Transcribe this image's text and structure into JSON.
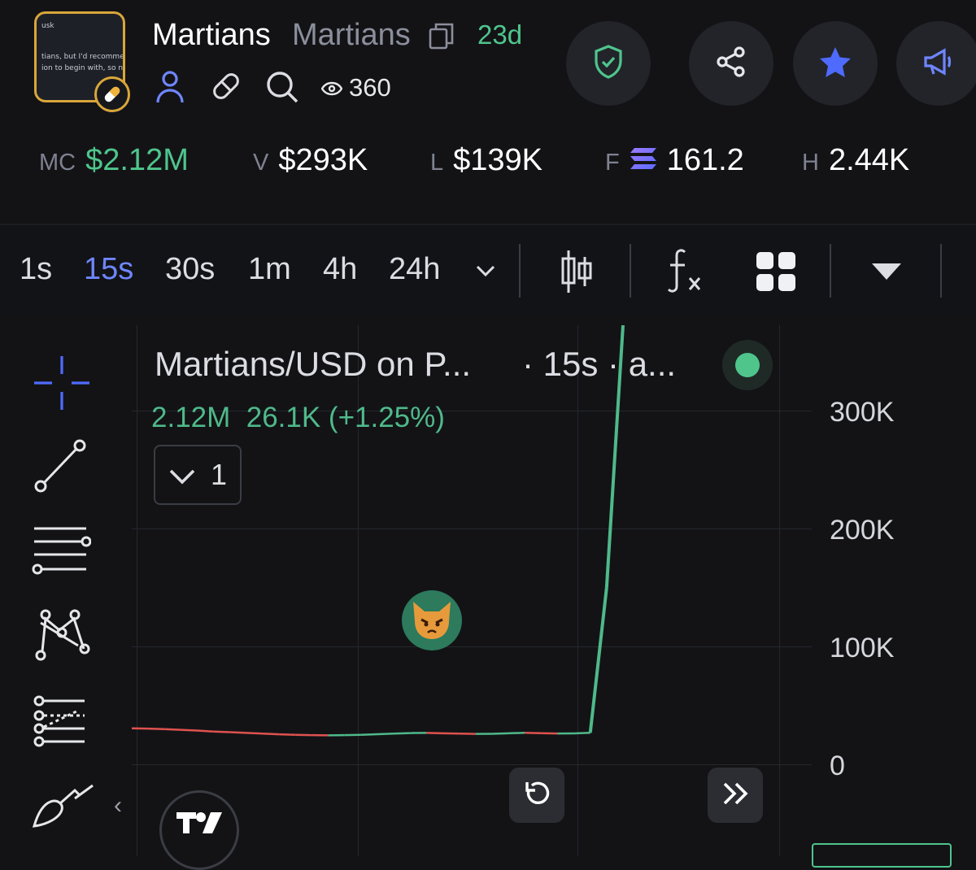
{
  "header": {
    "token_name": "Martians",
    "token_symbol": "Martians",
    "age": "23d",
    "views": "360",
    "avatar_tweet": {
      "handle": "usk",
      "line1": "tians, but I'd recommen",
      "line2": "ion to begin with, so no a"
    }
  },
  "stats": {
    "mc_label": "MC",
    "mc_value": "$2.12M",
    "v_label": "V",
    "v_value": "$293K",
    "l_label": "L",
    "l_value": "$139K",
    "f_label": "F",
    "f_value": "161.2",
    "h_label": "H",
    "h_value": "2.44K"
  },
  "timeframes": [
    "1s",
    "15s",
    "30s",
    "1m",
    "4h",
    "24h"
  ],
  "active_timeframe": "15s",
  "chart": {
    "legend_title": "Martians/USD on P...",
    "legend_tf": "· 15s · a...",
    "legend_value": "2.12M",
    "legend_change": "26.1K (+1.25%)",
    "indicator_count": "1",
    "colors": {
      "up": "#4fb98a",
      "down": "#e0524f",
      "accent": "#6f86ff"
    }
  },
  "chart_data": {
    "type": "line",
    "ylim": [
      0,
      300000
    ],
    "y_ticks": [
      "0",
      "100K",
      "200K",
      "300K"
    ],
    "series": [
      {
        "values": [
          30500,
          30300,
          29800,
          29200,
          28600,
          27800,
          27200,
          26600,
          26000,
          25400,
          25000,
          24700,
          24600,
          24700,
          25000,
          25500,
          26000,
          26500,
          26600,
          26300,
          26000,
          25800,
          25900,
          26300,
          26700,
          26400,
          26100,
          26200,
          26700,
          150000,
          380000
        ]
      }
    ]
  }
}
